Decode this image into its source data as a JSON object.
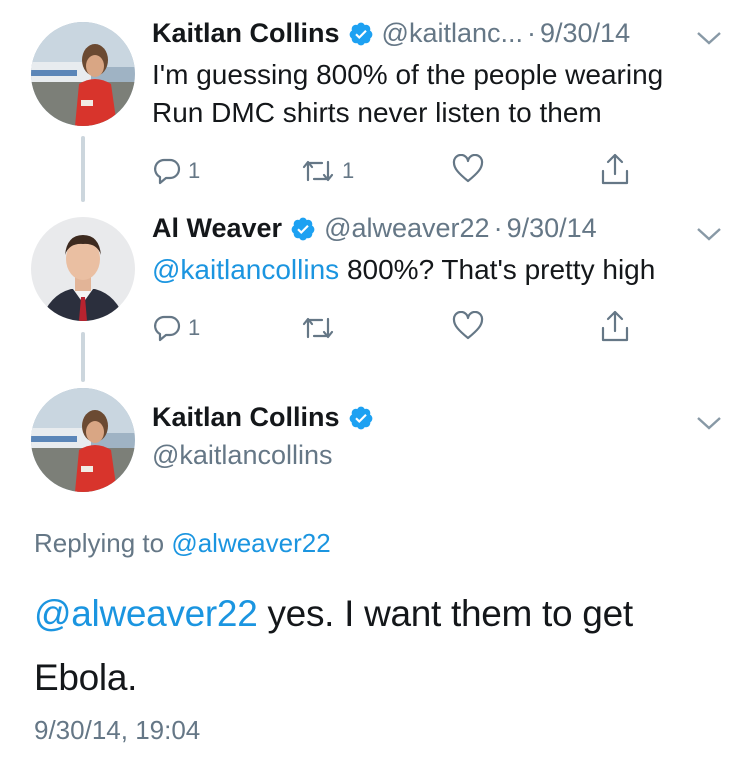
{
  "tweet1": {
    "name": "Kaitlan Collins",
    "handle": "@kaitlanc...",
    "separator": "·",
    "date": "9/30/14",
    "text": "I'm guessing 800% of the people wearing Run DMC shirts never listen to them",
    "reply_count": "1",
    "retweet_count": "1"
  },
  "tweet2": {
    "name": "Al Weaver",
    "handle": "@alweaver22",
    "separator": "·",
    "date": "9/30/14",
    "mention": "@kaitlancollins",
    "text": " 800%? That's pretty high",
    "reply_count": "1"
  },
  "tweet3": {
    "name": "Kaitlan Collins",
    "handle": "@kaitlancollins",
    "replying_label": "Replying to ",
    "replying_handle": "@alweaver22",
    "mention": "@alweaver22",
    "text": " yes. I want them to get Ebola.",
    "timestamp": "9/30/14, 19:04"
  },
  "colors": {
    "accent": "#1b95e0",
    "muted": "#657786",
    "verified": "#1da1f2",
    "thread_line": "#ccd6dd"
  },
  "icons": [
    "verified-badge-icon",
    "chevron-down-icon",
    "reply-icon",
    "retweet-icon",
    "like-icon",
    "share-icon"
  ]
}
